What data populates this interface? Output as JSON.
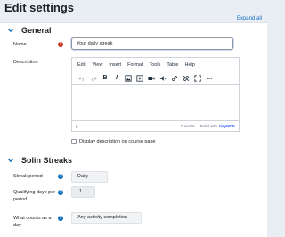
{
  "page": {
    "title": "Edit settings",
    "expand_all": "Expand all"
  },
  "general": {
    "title": "General",
    "name_label": "Name",
    "name_value": "Your daily streak",
    "description_label": "Description",
    "editor": {
      "menu": [
        "Edit",
        "View",
        "Insert",
        "Format",
        "Tools",
        "Table",
        "Help"
      ],
      "toolbar": [
        "undo-icon",
        "redo-icon",
        "B",
        "I",
        "image-icon",
        "media-icon",
        "video-icon",
        "audio-icon",
        "link-icon",
        "unlink-icon",
        "fullscreen-icon",
        "more-icon"
      ],
      "status_path": "p",
      "word_count": "0 words",
      "built_with": "Build with",
      "brand": "tinyMCE"
    },
    "display_description_label": "Display description on course page"
  },
  "solin": {
    "title": "Solin Streaks",
    "streak_period_label": "Streak period",
    "streak_period_value": "Daily",
    "qualifying_days_label_1": "Qualifying days per",
    "qualifying_days_label_2": "period",
    "qualifying_days_value": "1",
    "counts_label_1": "What counts as a",
    "counts_label_2": "day",
    "counts_value": "Any activity completion"
  },
  "colors": {
    "accent": "#0f6cbf",
    "required": "#ca3120",
    "background": "#e9eef5"
  }
}
